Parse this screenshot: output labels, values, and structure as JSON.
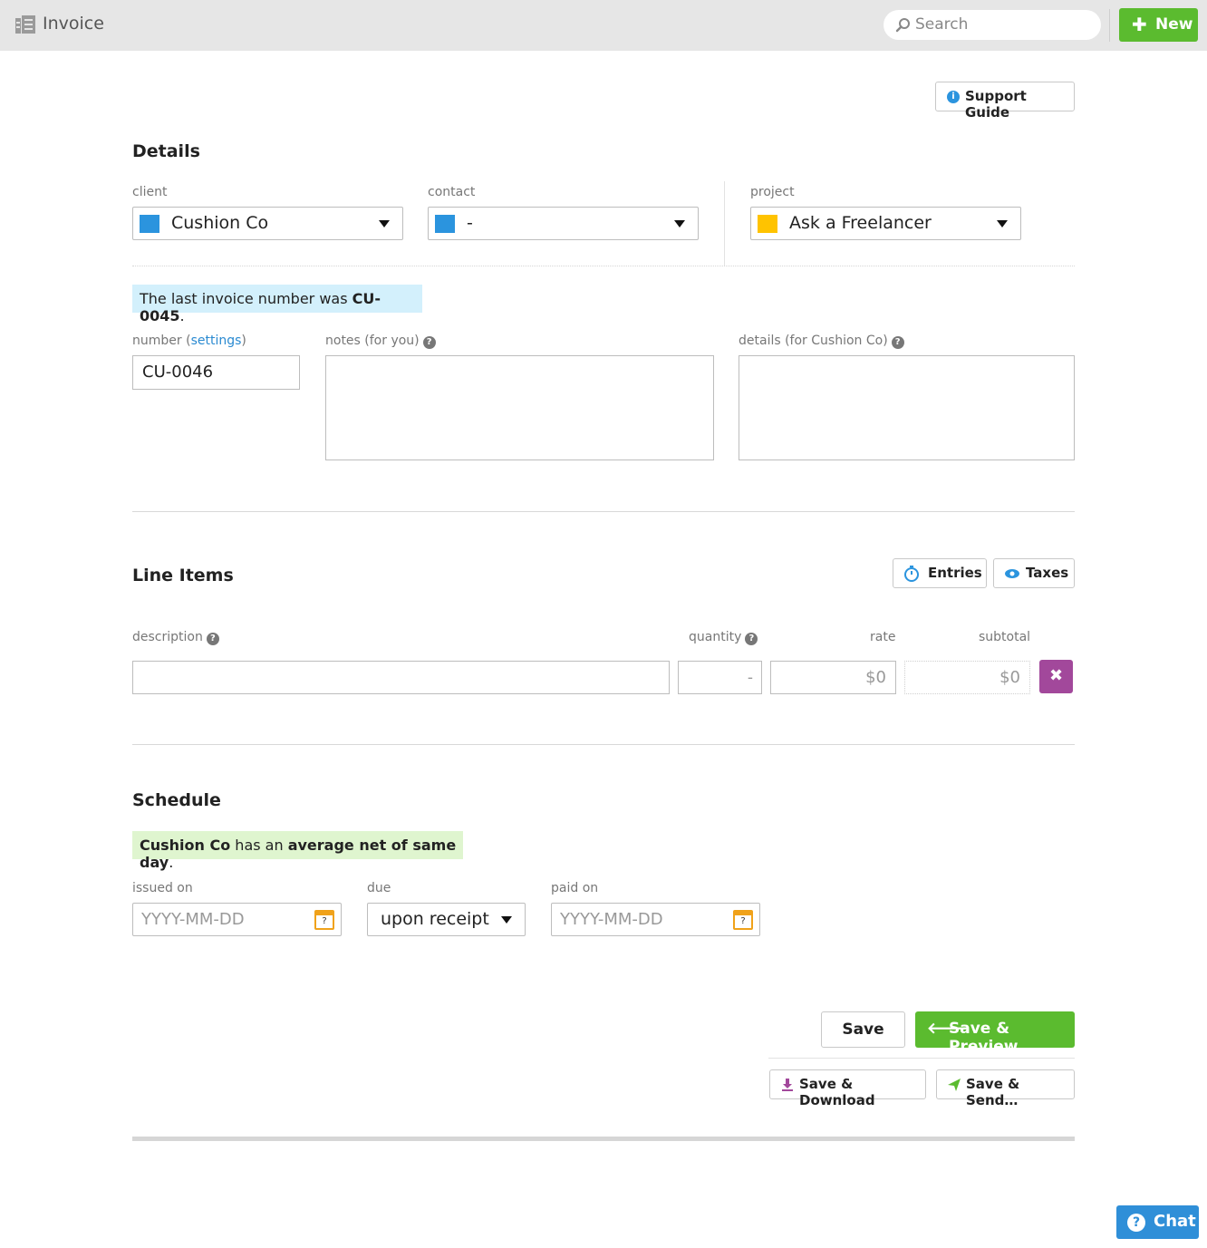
{
  "topbar": {
    "title": "Invoice",
    "search_placeholder": "Search",
    "new_label": "New"
  },
  "support_guide_label": "Support Guide",
  "details": {
    "title": "Details",
    "client_label": "client",
    "client_value": "Cushion Co",
    "client_color": "#2b94de",
    "contact_label": "contact",
    "contact_value": "-",
    "contact_color": "#2b94de",
    "project_label": "project",
    "project_value": "Ask a Freelancer",
    "project_color": "#ffc300",
    "last_invoice_prefix": "The last invoice number was ",
    "last_invoice_number": "CU-0045",
    "last_invoice_suffix": ".",
    "number_label": "number",
    "number_settings_open": "(",
    "number_settings_link": "settings",
    "number_settings_close": ")",
    "number_value": "CU-0046",
    "notes_label": "notes (for you)",
    "notes_value": "",
    "details_label": "details (for Cushion Co)",
    "details_value": ""
  },
  "line_items": {
    "title": "Line Items",
    "entries_label": "Entries",
    "taxes_label": "Taxes",
    "col_description": "description",
    "col_quantity": "quantity",
    "col_rate": "rate",
    "col_subtotal": "subtotal",
    "rows": [
      {
        "description": "",
        "quantity": "-",
        "rate": "$0",
        "subtotal": "$0"
      }
    ]
  },
  "schedule": {
    "title": "Schedule",
    "notice_client": "Cushion Co",
    "notice_mid": " has an ",
    "notice_bold": "average net of same day",
    "notice_end": ".",
    "issued_label": "issued on",
    "issued_placeholder": "YYYY-MM-DD",
    "due_label": "due",
    "due_value": "upon receipt",
    "paid_label": "paid on",
    "paid_placeholder": "YYYY-MM-DD",
    "calendar_glyph": "?"
  },
  "actions": {
    "save_label": "Save",
    "save_preview_label": "Save & Preview",
    "save_download_label": "Save & Download",
    "save_send_label": "Save & Send…"
  },
  "chat_label": "Chat",
  "colors": {
    "green": "#5bbb2f",
    "blue": "#2b94de",
    "purple": "#a2489b",
    "notice_blue_bg": "#d3f0fc",
    "notice_green_bg": "#dff5cf"
  }
}
